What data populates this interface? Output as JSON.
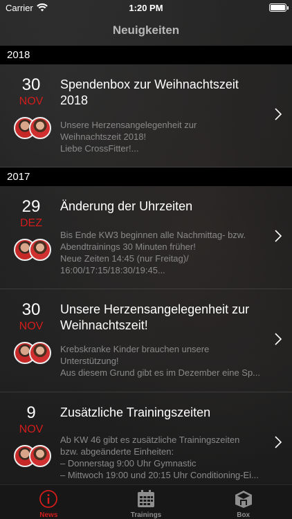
{
  "status_bar": {
    "carrier": "Carrier",
    "time": "1:20 PM"
  },
  "nav": {
    "title": "Neuigkeiten"
  },
  "sections": [
    {
      "year": "2018",
      "items": [
        {
          "day": "30",
          "month": "NOV",
          "title": "Spendenbox zur Weihnachtszeit 2018",
          "body": "Unsere Herzensangelegenheit zur\nWeihnachtszeit 2018!\nLiebe CrossFitter!..."
        }
      ]
    },
    {
      "year": "2017",
      "items": [
        {
          "day": "29",
          "month": "DEZ",
          "title": "Änderung der Uhrzeiten",
          "body": "Bis Ende KW3 beginnen alle Nachmittag- bzw.\nAbendtrainings 30 Minuten früher!\nNeue Zeiten 14:45 (nur Freitag)/\n16:00/17:15/18:30/19:45..."
        },
        {
          "day": "30",
          "month": "NOV",
          "title": "Unsere Herzensangelegenheit zur Weihnachtszeit!",
          "body": "Krebskranke Kinder brauchen unsere\nUnterstützung!\nAus diesem Grund gibt es im Dezember eine Sp..."
        },
        {
          "day": "9",
          "month": "NOV",
          "title": "Zusätzliche Trainingszeiten",
          "body": "Ab KW 46 gibt es zusätzliche Trainingszeiten\nbzw. abgeänderte Einheiten:\n– Donnerstag 9:00 Uhr Gymnastic\n– Mittwoch 19:00 und 20:15 Uhr Conditioning-Ei..."
        }
      ]
    }
  ],
  "tabs": [
    {
      "label": "News",
      "icon": "info-circle-icon",
      "active": true
    },
    {
      "label": "Trainings",
      "icon": "calendar-icon",
      "active": false
    },
    {
      "label": "Box",
      "icon": "box-icon",
      "active": false
    }
  ],
  "colors": {
    "accent": "#d21c1c",
    "section_bg": "#000000",
    "tab_inactive": "#8e8e8e"
  }
}
